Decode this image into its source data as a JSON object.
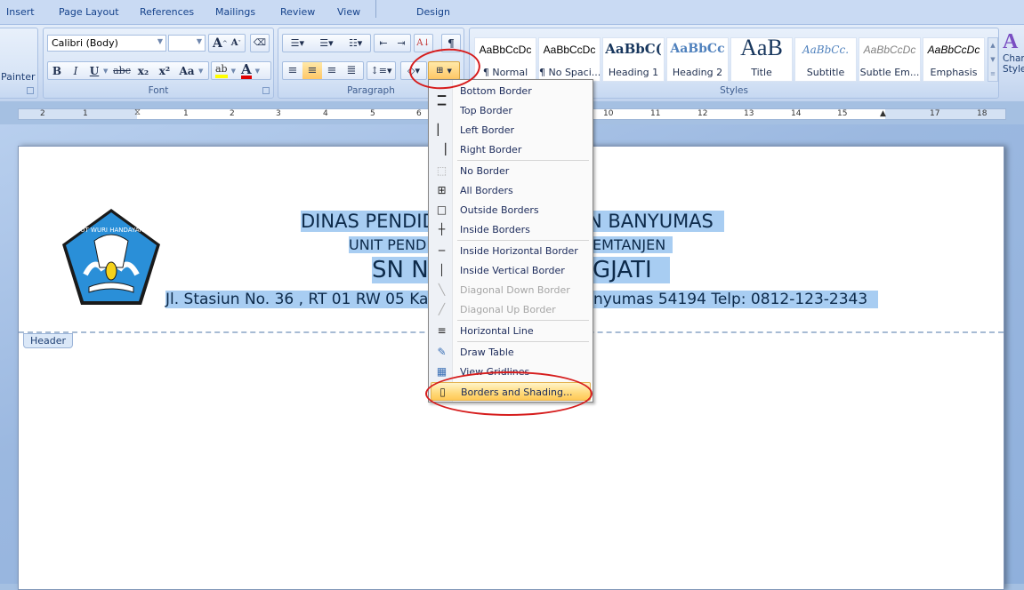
{
  "tabs": [
    "Insert",
    "Page Layout",
    "References",
    "Mailings",
    "Review",
    "View",
    "Design"
  ],
  "clipboard": {
    "painter_label": "Painter"
  },
  "font": {
    "group_label": "Font",
    "font_name": "Calibri (Body)",
    "font_size": "",
    "grow_label": "A",
    "shrink_label": "A",
    "bold": "B",
    "italic": "I",
    "underline": "U",
    "strike": "abc",
    "subscript": "x₂",
    "superscript": "x²",
    "case": "Aa",
    "highlight": "ab",
    "font_color": "A",
    "highlight_color": "#ffff00",
    "font_color_value": "#e00000"
  },
  "paragraph": {
    "group_label": "Paragraph"
  },
  "styles": {
    "group_label": "Styles",
    "items": [
      {
        "sample": "AaBbCcDc",
        "name": "¶ Normal"
      },
      {
        "sample": "AaBbCcDc",
        "name": "¶ No Spaci..."
      },
      {
        "sample": "AaBbC(",
        "name": "Heading 1"
      },
      {
        "sample": "AaBbCc",
        "name": "Heading 2"
      },
      {
        "sample": "AaB",
        "name": "Title"
      },
      {
        "sample": "AaBbCc.",
        "name": "Subtitle"
      },
      {
        "sample": "AaBbCcDc",
        "name": "Subtle Em..."
      },
      {
        "sample": "AaBbCcDc",
        "name": "Emphasis"
      }
    ],
    "change_styles_label_1": "Char",
    "change_styles_label_2": "Style"
  },
  "ruler": {
    "left_ticks": [
      "2",
      "1"
    ],
    "right_ticks": [
      "1",
      "2",
      "3",
      "4",
      "5",
      "6",
      "10",
      "11",
      "12",
      "13",
      "14",
      "15",
      "17",
      "18"
    ]
  },
  "document": {
    "line1": "DINAS PENDIDIKAN KABUPATEN BANYUMAS",
    "line2": "UNIT PENDIDIKAN KECAMATAN KEMTANJEN",
    "line3": "SN NEGERI SUKAJATI",
    "line4": "Jl. Stasiun No. 36 , RT 01 RW 05 Kar... Banyumas 54194 Telp: 0812-123-2343",
    "line1_left": "DINAS PENDID",
    "line1_right": "N BANYUMAS",
    "line2_left": "UNIT PEND",
    "line2_right": "EMTANJEN",
    "line3_left": "SN NI",
    "line3_right": "GJATI",
    "line4_left": "Jl. Stasiun No. 36 , RT 01 RW 05 Kar",
    "line4_right": "nyumas 54194 Telp: 0812-123-2343",
    "logo_text": "TUT WURI HANDAYANI",
    "header_tag": "Header"
  },
  "border_menu": {
    "items": [
      {
        "label": "Bottom Border",
        "icon": "bottom-border-icon",
        "enabled": true
      },
      {
        "label": "Top Border",
        "icon": "top-border-icon",
        "enabled": true
      },
      {
        "label": "Left Border",
        "icon": "left-border-icon",
        "enabled": true
      },
      {
        "label": "Right Border",
        "icon": "right-border-icon",
        "enabled": true
      },
      {
        "label": "No Border",
        "icon": "no-border-icon",
        "enabled": true
      },
      {
        "label": "All Borders",
        "icon": "all-borders-icon",
        "enabled": true
      },
      {
        "label": "Outside Borders",
        "icon": "outside-borders-icon",
        "enabled": true
      },
      {
        "label": "Inside Borders",
        "icon": "inside-borders-icon",
        "enabled": true
      },
      {
        "label": "Inside Horizontal Border",
        "icon": "inside-horizontal-border-icon",
        "enabled": true
      },
      {
        "label": "Inside Vertical Border",
        "icon": "inside-vertical-border-icon",
        "enabled": true
      },
      {
        "label": "Diagonal Down Border",
        "icon": "diagonal-down-border-icon",
        "enabled": false
      },
      {
        "label": "Diagonal Up Border",
        "icon": "diagonal-up-border-icon",
        "enabled": false
      },
      {
        "label": "Horizontal Line",
        "icon": "horizontal-line-icon",
        "enabled": true
      },
      {
        "label": "Draw Table",
        "icon": "draw-table-icon",
        "enabled": true
      },
      {
        "label": "View Gridlines",
        "icon": "view-gridlines-icon",
        "enabled": true
      },
      {
        "label": "Borders and Shading...",
        "icon": "borders-shading-icon",
        "enabled": true,
        "highlighted": true
      }
    ]
  },
  "annotation_color": "#d61d1d"
}
